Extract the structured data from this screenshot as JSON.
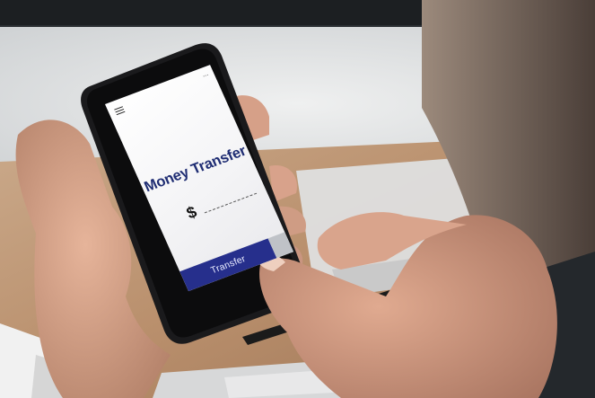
{
  "photo": {
    "subject": "hands holding smartphone with money transfer app"
  },
  "app": {
    "menu_icon": "hamburger-menu-icon",
    "more_icon": "more-dots-icon",
    "more_dots": "...",
    "title": "Money Transfer",
    "currency_symbol": "$",
    "amount_value": "",
    "transfer_button_label": "Transfer",
    "accent_color": "#262f8c",
    "title_color": "#1f2d73"
  }
}
